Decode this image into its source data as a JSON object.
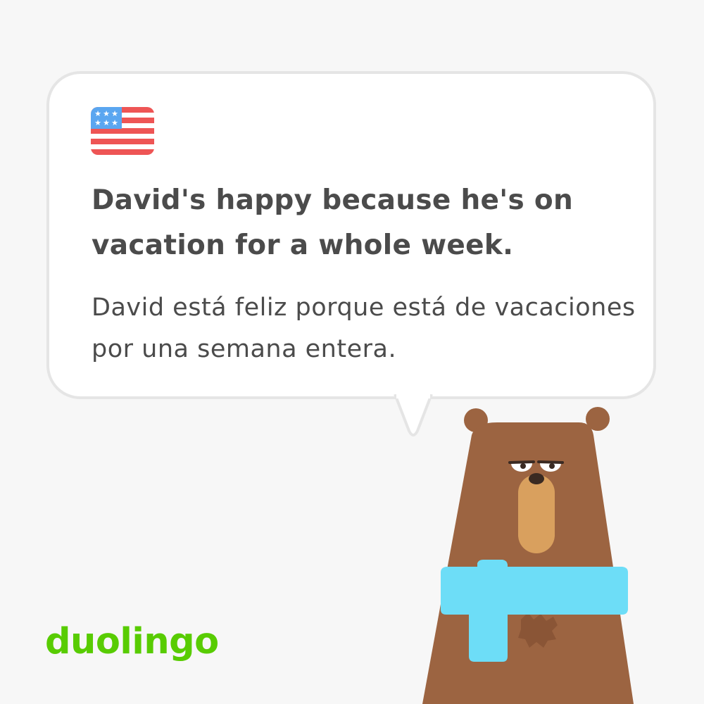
{
  "card": {
    "flag_icon": "us-flag-icon",
    "english_sentence": "David's happy because he's on vacation for a whole week.",
    "spanish_sentence": "David está feliz porque está de vacaciones por una semana entera."
  },
  "brand": {
    "logo_text": "duolingo",
    "logo_color": "#58cc02"
  },
  "character": {
    "icon": "bear-with-scarf-icon",
    "fur_color": "#9c6441",
    "scarf_color": "#6dddf7",
    "snout_color": "#d9a05e"
  },
  "colors": {
    "background": "#f7f7f7",
    "bubble_border": "#e5e5e5",
    "text": "#4b4b4b"
  }
}
